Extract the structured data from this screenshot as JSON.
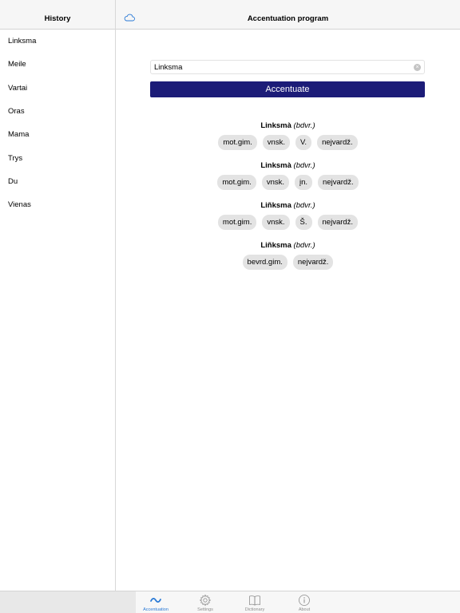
{
  "sidebar": {
    "title": "History",
    "items": [
      "Linksma",
      "Meile",
      "Vartai",
      "Oras",
      "Mama",
      "Trys",
      "Du",
      "Vienas"
    ]
  },
  "main": {
    "title": "Accentuation program",
    "search": {
      "value": "Linksma",
      "placeholder": ""
    },
    "accentuate_label": "Accentuate",
    "results": [
      {
        "word": "Linksmà",
        "pos": "(bdvr.)",
        "tags": [
          "mot.gim.",
          "vnsk.",
          "V.",
          "nejvardž."
        ]
      },
      {
        "word": "Linksmà",
        "pos": "(bdvr.)",
        "tags": [
          "mot.gim.",
          "vnsk.",
          "įn.",
          "nejvardž."
        ]
      },
      {
        "word": "Liñksma",
        "pos": "(bdvr.)",
        "tags": [
          "mot.gim.",
          "vnsk.",
          "Š.",
          "nejvardž."
        ]
      },
      {
        "word": "Liñksma",
        "pos": "(bdvr.)",
        "tags": [
          "bevrd.gim.",
          "nejvardž."
        ]
      }
    ]
  },
  "tabbar": {
    "tabs": [
      {
        "label": "Accentuation",
        "icon": "tilde-icon",
        "active": true
      },
      {
        "label": "Settings",
        "icon": "gear-icon",
        "active": false
      },
      {
        "label": "Dictionary",
        "icon": "book-icon",
        "active": false
      },
      {
        "label": "About",
        "icon": "info-icon",
        "active": false
      }
    ]
  },
  "colors": {
    "accent": "#1c1c78",
    "tab_active": "#2a7ad6",
    "tag_bg": "#e3e3e3"
  }
}
